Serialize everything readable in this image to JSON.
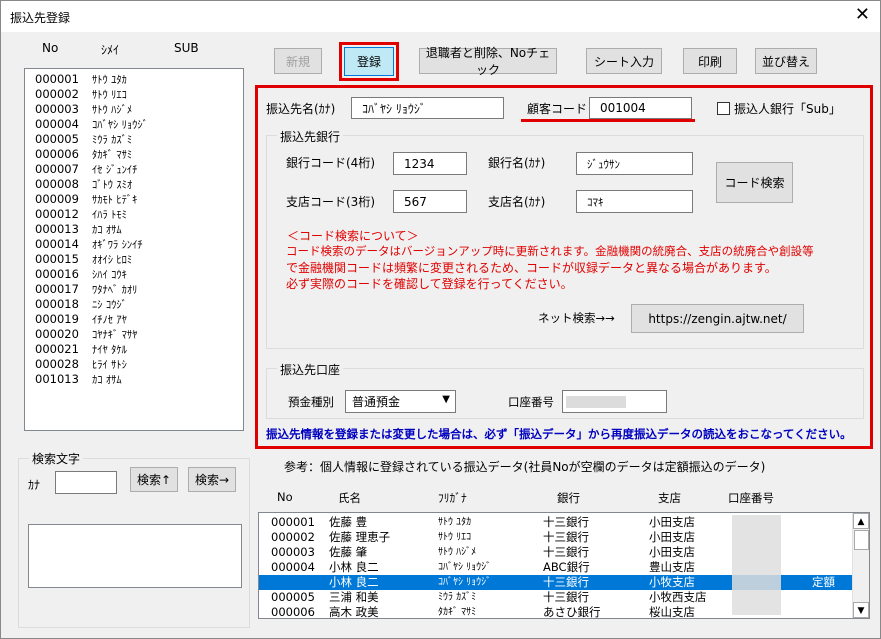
{
  "window": {
    "title": "振込先登録",
    "close_glyph": "✕"
  },
  "left": {
    "headers": {
      "no": "No",
      "name": "ｼﾒｲ",
      "sub": "SUB"
    },
    "rows": [
      {
        "no": "000001",
        "name": "ｻﾄｳ ﾕﾀｶ"
      },
      {
        "no": "000002",
        "name": "ｻﾄｳ ﾘｴｺ"
      },
      {
        "no": "000003",
        "name": "ｻﾄｳ ﾊｼﾞﾒ"
      },
      {
        "no": "000004",
        "name": "ｺﾊﾞﾔｼ ﾘｮｳｼﾞ"
      },
      {
        "no": "000005",
        "name": "ﾐｳﾗ ｶｽﾞﾐ"
      },
      {
        "no": "000006",
        "name": "ﾀｶｷﾞ ﾏｻﾐ"
      },
      {
        "no": "000007",
        "name": "ｲｾ ｼﾞｭﾝｲﾁ"
      },
      {
        "no": "000008",
        "name": "ｺﾞﾄｳ ｽﾐｵ"
      },
      {
        "no": "000009",
        "name": "ｻｶﾓﾄ ﾋﾃﾞｷ"
      },
      {
        "no": "000012",
        "name": "ｲﾊﾗ ﾄﾓﾐ"
      },
      {
        "no": "000013",
        "name": "ｶｺ ｵｻﾑ"
      },
      {
        "no": "000014",
        "name": "ｵｷﾞﾜﾗ ｼﾝｲﾁ"
      },
      {
        "no": "000015",
        "name": "ｵｵｲｼ ﾋﾛﾐ"
      },
      {
        "no": "000016",
        "name": "ｼﾊｲ ｺｳｷ"
      },
      {
        "no": "000017",
        "name": "ﾜﾀﾅﾍﾞ ｶｵﾘ"
      },
      {
        "no": "000018",
        "name": "ﾆｼ ｺｳｼﾞ"
      },
      {
        "no": "000019",
        "name": "ｲﾁﾉｾ ｱﾔ"
      },
      {
        "no": "000020",
        "name": "ｺﾔﾅｷﾞ ﾏｻﾔ"
      },
      {
        "no": "000021",
        "name": "ﾅｲﾔ ﾀｹﾙ"
      },
      {
        "no": "000028",
        "name": "ﾋﾗｲ ｻﾄｼ"
      },
      {
        "no": "001013",
        "name": "ｶｺ ｵｻﾑ"
      }
    ],
    "search": {
      "group_title": "検索文字",
      "kana_label": "ｶﾅ",
      "up_button": "検索↑",
      "next_button": "検索→",
      "value": ""
    }
  },
  "toolbar": {
    "new": "新規",
    "register": "登録",
    "retire_delete": "退職者と削除、Noチェック",
    "sheet_input": "シート入力",
    "print": "印刷",
    "sort": "並び替え"
  },
  "form": {
    "payee_name_label": "振込先名(ｶﾅ)",
    "payee_name_value": "ｺﾊﾞﾔｼ ﾘｮｳｼﾞ",
    "customer_code_label": "顧客コード",
    "customer_code_value": "001004",
    "sub_checkbox_label": "振込人銀行「Sub」",
    "bank_group_title": "振込先銀行",
    "bank_code_label": "銀行コード(4桁)",
    "bank_code_value": "1234",
    "bank_name_label": "銀行名(ｶﾅ)",
    "bank_name_value": "ｼﾞｭｳｻﾝ",
    "branch_code_label": "支店コード(3桁)",
    "branch_code_value": "567",
    "branch_name_label": "支店名(ｶﾅ)",
    "branch_name_value": "ｺﾏｷ",
    "code_search_button": "コード検索",
    "notes": [
      "＜コード検索について＞",
      "コード検索のデータはバージョンアップ時に更新されます。金融機関の統廃合、支店の統廃合や創設等",
      "で金融機関コードは頻繁に変更されるため、コードが収録データと異なる場合があります。",
      "必ず実際のコードを確認して登録を行ってください。"
    ],
    "net_search_label": "ネット検索→→",
    "net_search_button": "https://zengin.ajtw.net/",
    "account_group_title": "振込先口座",
    "deposit_type_label": "預金種別",
    "deposit_type_value": "普通預金",
    "account_number_label": "口座番号",
    "account_number_value": "",
    "blue_note": "振込先情報を登録または変更した場合は、必ず「振込データ」から再度振込データの読込をおこなってください。"
  },
  "reference": {
    "caption": "参考：個人情報に登録されている振込データ(社員Noが空欄のデータは定額振込のデータ)",
    "headers": {
      "no": "No",
      "name": "氏名",
      "kana": "ﾌﾘｶﾞﾅ",
      "bank": "銀行",
      "branch": "支店",
      "account": "口座番号"
    },
    "rows": [
      {
        "no": "000001",
        "name": "佐藤 豊",
        "kana": "ｻﾄｳ ﾕﾀｶ",
        "bank": "十三銀行",
        "branch": "小田支店",
        "account": "",
        "extra": "",
        "selected": false
      },
      {
        "no": "000002",
        "name": "佐藤 理恵子",
        "kana": "ｻﾄｳ ﾘｴｺ",
        "bank": "十三銀行",
        "branch": "小田支店",
        "account": "",
        "extra": "",
        "selected": false
      },
      {
        "no": "000003",
        "name": "佐藤 肇",
        "kana": "ｻﾄｳ ﾊｼﾞﾒ",
        "bank": "十三銀行",
        "branch": "小田支店",
        "account": "",
        "extra": "",
        "selected": false
      },
      {
        "no": "000004",
        "name": "小林 良二",
        "kana": "ｺﾊﾞﾔｼ ﾘｮｳｼﾞ",
        "bank": "ABC銀行",
        "branch": "豊山支店",
        "account": "",
        "extra": "",
        "selected": false
      },
      {
        "no": "",
        "name": "小林 良二",
        "kana": "ｺﾊﾞﾔｼ ﾘｮｳｼﾞ",
        "bank": "十三銀行",
        "branch": "小牧支店",
        "account": "",
        "extra": "定額",
        "selected": true
      },
      {
        "no": "000005",
        "name": "三浦 和美",
        "kana": "ﾐｳﾗ ｶｽﾞﾐ",
        "bank": "十三銀行",
        "branch": "小牧西支店",
        "account": "",
        "extra": "",
        "selected": false
      },
      {
        "no": "000006",
        "name": "高木 政美",
        "kana": "ﾀｶｷﾞ ﾏｻﾐ",
        "bank": "あさひ銀行",
        "branch": "桜山支店",
        "account": "",
        "extra": "",
        "selected": false
      }
    ]
  },
  "colors": {
    "highlight_red": "#e00000",
    "register_button": "#bfe9f4",
    "selection": "#0078d7",
    "note_blue": "#0000c0"
  }
}
